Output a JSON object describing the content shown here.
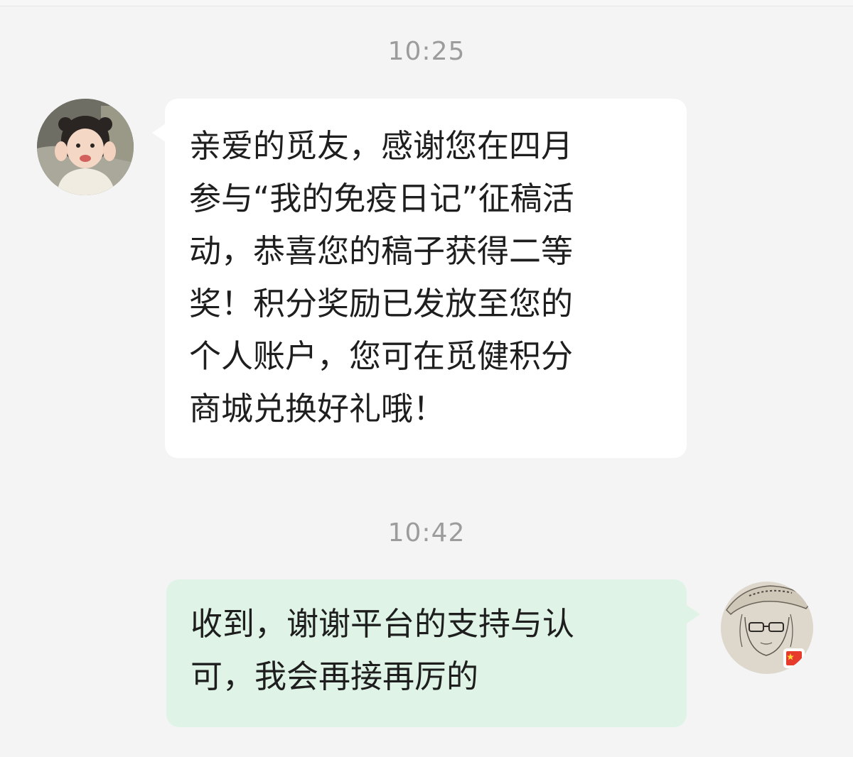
{
  "conversation": {
    "messages": [
      {
        "time": "10:25",
        "sender": "other",
        "avatar": "child-photo-avatar",
        "lines": [
          "亲爱的觅友，感谢您在四月",
          "参与“我的免疫日记”征稿活",
          "动，恭喜您的稿子获得二等",
          "奖！积分奖励已发放至您的",
          "个人账户，您可在觅健积分",
          "商城兑换好礼哦！"
        ]
      },
      {
        "time": "10:42",
        "sender": "self",
        "avatar": "sketch-portrait-avatar",
        "lines": [
          "收到，谢谢平台的支持与认",
          "可，我会再接再厉的"
        ]
      }
    ]
  },
  "colors": {
    "background": "#f4f4f4",
    "incoming_bubble": "#ffffff",
    "outgoing_bubble": "#dff4e7",
    "timestamp_text": "#9c9c9c",
    "message_text": "#1e1e1e"
  }
}
